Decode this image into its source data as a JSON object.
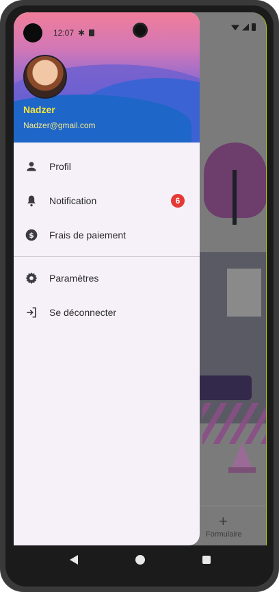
{
  "status_bar": {
    "time": "12:07"
  },
  "drawer": {
    "user": {
      "name": "Nadzer",
      "email": "Nadzer@gmail.com"
    },
    "items": [
      {
        "label": "Profil",
        "icon": "person-icon"
      },
      {
        "label": "Notification",
        "icon": "bell-icon",
        "badge": "6"
      },
      {
        "label": "Frais de paiement",
        "icon": "dollar-circle-icon"
      }
    ],
    "secondary_items": [
      {
        "label": "Paramètres",
        "icon": "gear-icon"
      },
      {
        "label": "Se déconnecter",
        "icon": "logout-icon"
      }
    ]
  },
  "background_app": {
    "bottom_nav": {
      "label": "Formulaire",
      "icon": "plus-icon"
    }
  },
  "colors": {
    "drawer_bg": "#f6f1f8",
    "name": "#f8e63a",
    "badge": "#e53935",
    "icon": "#3b3b40"
  }
}
